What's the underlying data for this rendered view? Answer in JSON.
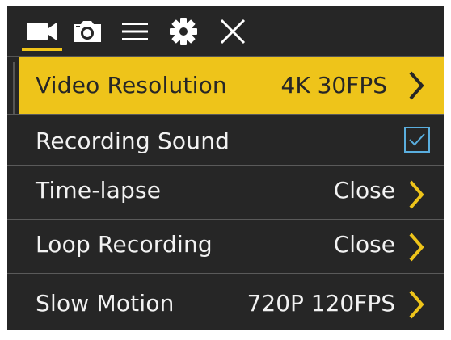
{
  "tabs": [
    {
      "icon": "video-camera-icon",
      "active": true
    },
    {
      "icon": "photo-camera-icon",
      "active": false
    },
    {
      "icon": "menu-icon",
      "active": false
    },
    {
      "icon": "gear-icon",
      "active": false
    },
    {
      "icon": "close-icon",
      "active": false
    }
  ],
  "colors": {
    "background": "#262626",
    "accent": "#eec41a",
    "text": "#f2f2f2",
    "checkbox": "#5aaede"
  },
  "menu": {
    "items": [
      {
        "label": "Video Resolution",
        "value": "4K 30FPS",
        "control": "chevron",
        "selected": true
      },
      {
        "label": "Recording Sound",
        "value": "",
        "control": "checkbox",
        "checked": true
      },
      {
        "label": "Time-lapse",
        "value": "Close",
        "control": "chevron"
      },
      {
        "label": "Loop Recording",
        "value": "Close",
        "control": "chevron"
      },
      {
        "label": "Slow Motion",
        "value": "720P 120FPS",
        "control": "chevron"
      }
    ]
  }
}
